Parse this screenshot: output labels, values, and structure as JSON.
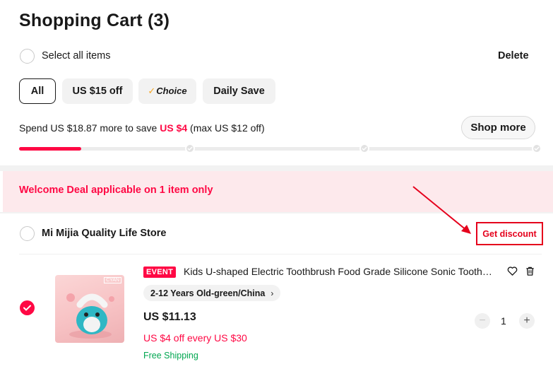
{
  "cart": {
    "title": "Shopping Cart (3)",
    "select_all_label": "Select all items",
    "delete_label": "Delete"
  },
  "filters": {
    "chips": [
      {
        "label": "All",
        "active": true
      },
      {
        "label": "US $15 off",
        "active": false
      },
      {
        "label": "Choice",
        "active": false,
        "icon": "checkmark-icon"
      },
      {
        "label": "Daily Save",
        "active": false
      }
    ]
  },
  "promo": {
    "spend_prefix": "Spend US $18.87 more to save ",
    "save_amount": "US $4",
    "spend_suffix": " (max US $12 off)",
    "shop_more_label": "Shop more",
    "progress": 0.12,
    "accent_color": "#ff0844"
  },
  "welcome": {
    "text": "Welcome Deal applicable on 1 item only"
  },
  "store": {
    "name": "Mi Mijia Quality Life Store",
    "discount_label": "Get discount",
    "highlight_color": "#e5001c"
  },
  "item": {
    "badge": "EVENT",
    "title": "Kids U-shaped Electric Toothbrush Food Grade Silicone Sonic Toothbrush",
    "thumb_tag": "CYAN",
    "variant": "2-12 Years Old-green/China",
    "price": "US $11.13",
    "discount_text": "US $4 off every US $30",
    "shipping": "Free Shipping",
    "quantity": "1",
    "selected": true
  }
}
